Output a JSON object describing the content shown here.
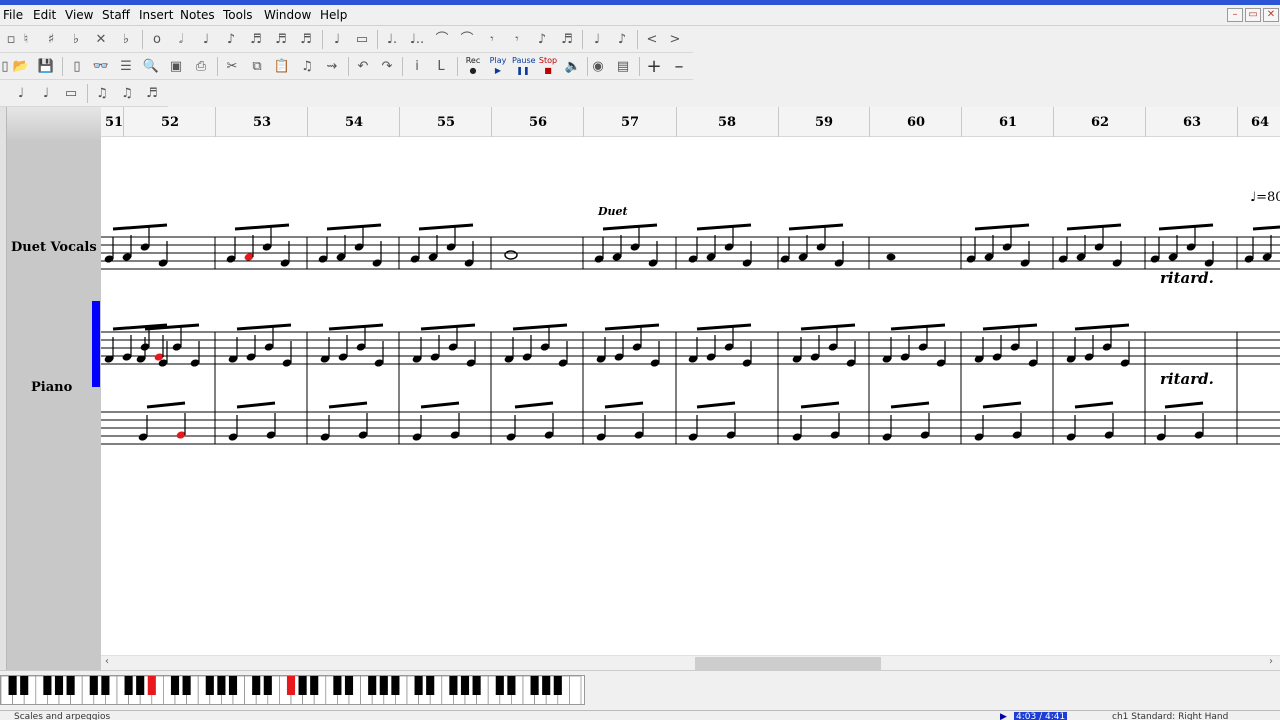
{
  "menu": {
    "items": [
      "File",
      "Edit",
      "View",
      "Staff",
      "Insert",
      "Notes",
      "Tools",
      "Window",
      "Help"
    ]
  },
  "window_controls": {
    "minimize": "–",
    "restore": "▭",
    "close": "✕"
  },
  "toolbar": {
    "play": "Play",
    "pause": "Pause",
    "stop": "Stop",
    "rec": "Rec",
    "plus": "+",
    "minus": "–"
  },
  "staves": {
    "vocals": "Duet Vocals",
    "piano": "Piano"
  },
  "measures": [
    "51",
    "52",
    "53",
    "54",
    "55",
    "56",
    "57",
    "58",
    "59",
    "60",
    "61",
    "62",
    "63",
    "64"
  ],
  "score": {
    "duet_text": "Duet",
    "ritard_vocals": "ritard.",
    "ritard_piano": "ritard.",
    "tempo_marking": "♩=80"
  },
  "scrollbar": {
    "left_arrow": "‹",
    "right_arrow": "›"
  },
  "keyboard": {
    "active_color": "#e8191c"
  },
  "status": {
    "left": "Scales and arpeggios",
    "time": "4:03 / 4:41",
    "right": "ch1 Standard: Right Hand"
  },
  "colors": {
    "accent": "#2b55d6",
    "selection": "#0000ff",
    "highlight_note": "#e8191c"
  }
}
